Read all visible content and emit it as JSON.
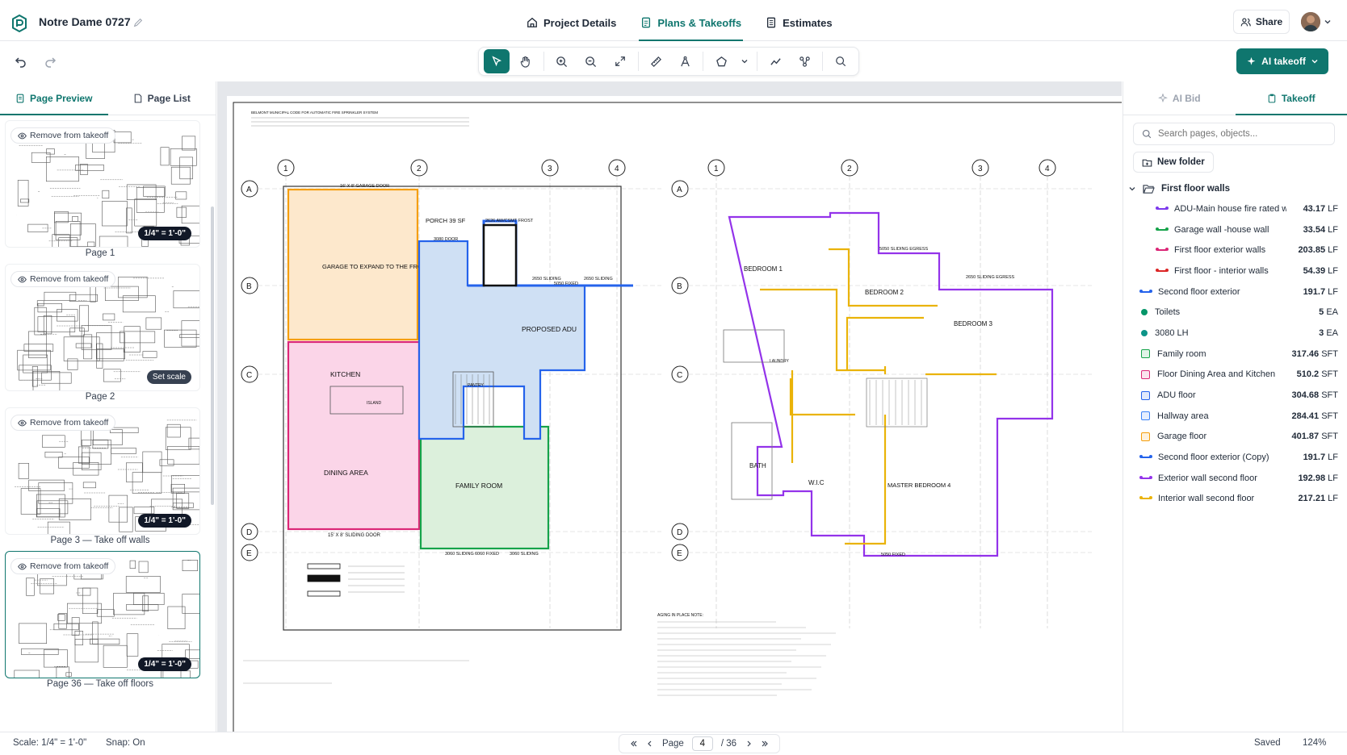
{
  "header": {
    "project_name": "Notre Dame 0727",
    "tabs": [
      "Project Details",
      "Plans & Takeoffs",
      "Estimates"
    ],
    "share_label": "Share"
  },
  "toolbar": {
    "ai_takeoff_label": "AI takeoff"
  },
  "left_panel": {
    "tabs": [
      "Page Preview",
      "Page List"
    ],
    "remove_label": "Remove from takeoff",
    "pages": [
      {
        "label": "Page 1",
        "badge": "1/4\" = 1'-0\""
      },
      {
        "label": "Page 2",
        "badge": "Set scale"
      },
      {
        "label": "Page 3 — Take off walls",
        "badge": "1/4\" = 1'-0\""
      },
      {
        "label": "Page 36 — Take off floors",
        "badge": "1/4\" = 1'-0\""
      }
    ]
  },
  "right_panel": {
    "tabs": [
      "AI Bid",
      "Takeoff"
    ],
    "search_placeholder": "Search pages, objects...",
    "new_folder_label": "New folder",
    "folder_name": "First floor walls",
    "items": [
      {
        "name": "ADU-Main house fire rated wall",
        "qty": "43.17",
        "unit": "LF",
        "color": "#7c3aed",
        "kind": "line",
        "indent": true
      },
      {
        "name": "Garage wall -house wall",
        "qty": "33.54",
        "unit": "LF",
        "color": "#16a34a",
        "kind": "line",
        "indent": true
      },
      {
        "name": "First floor exterior walls",
        "qty": "203.85",
        "unit": "LF",
        "color": "#db2777",
        "kind": "line",
        "indent": true
      },
      {
        "name": "First floor - interior walls",
        "qty": "54.39",
        "unit": "LF",
        "color": "#dc2626",
        "kind": "line",
        "indent": true
      },
      {
        "name": "Second floor exterior",
        "qty": "191.7",
        "unit": "LF",
        "color": "#2563eb",
        "kind": "line",
        "indent": false
      },
      {
        "name": "Toilets",
        "qty": "5",
        "unit": "EA",
        "color": "#059669",
        "kind": "dot",
        "indent": false
      },
      {
        "name": "3080 LH",
        "qty": "3",
        "unit": "EA",
        "color": "#0d9488",
        "kind": "dot",
        "indent": false
      },
      {
        "name": "Family room",
        "qty": "317.46",
        "unit": "SFT",
        "color": "#16a34a",
        "kind": "box",
        "indent": false
      },
      {
        "name": "Floor Dining Area and Kitchen",
        "qty": "510.2",
        "unit": "SFT",
        "color": "#db2777",
        "kind": "box",
        "indent": false
      },
      {
        "name": "ADU floor",
        "qty": "304.68",
        "unit": "SFT",
        "color": "#2563eb",
        "kind": "box",
        "indent": false
      },
      {
        "name": "Hallway area",
        "qty": "284.41",
        "unit": "SFT",
        "color": "#3b82f6",
        "kind": "box",
        "indent": false
      },
      {
        "name": "Garage floor",
        "qty": "401.87",
        "unit": "SFT",
        "color": "#f59e0b",
        "kind": "box",
        "indent": false
      },
      {
        "name": "Second floor exterior (Copy)",
        "qty": "191.7",
        "unit": "LF",
        "color": "#2563eb",
        "kind": "line",
        "indent": false
      },
      {
        "name": "Exterior wall second floor",
        "qty": "192.98",
        "unit": "LF",
        "color": "#9333ea",
        "kind": "line",
        "indent": false
      },
      {
        "name": "Interior wall second floor",
        "qty": "217.21",
        "unit": "LF",
        "color": "#eab308",
        "kind": "line",
        "indent": false
      }
    ]
  },
  "plan": {
    "note_top": "BELMONT MUNICIPAL CODE FOR AUTOMATIC FIRE SPRINKLER SYSTEM",
    "grid_cols": [
      "1",
      "2",
      "3",
      "4"
    ],
    "grid_rows": [
      "A",
      "B",
      "C",
      "D",
      "E"
    ],
    "rooms_left": {
      "garage": "GARAGE TO EXPAND TO THE FRONT",
      "garage_door": "16' X 8' GARAGE DOOR",
      "porch": "PORCH 39 SF",
      "adu": "PROPOSED ADU",
      "kitchen": "KITCHEN",
      "island": "ISLAND",
      "dining": "DINING AREA",
      "family": "FAMILY ROOM",
      "sliding_door": "15' X 8' SLIDING DOOR",
      "pantry": "PANTRY",
      "w3080": "3080 DOOR",
      "s3060a": "3060 SLIDING",
      "f6060": "6060 FIXED",
      "s3060b": "3060 SLIDING",
      "w2626": "2626 AW/CSMT FROST",
      "w2650a": "2650 SLIDING",
      "w5050": "5050 FIXED",
      "w2650b": "2650 SLIDING"
    },
    "rooms_right": {
      "bed1": "BEDROOM 1",
      "bed2": "BEDROOM 2",
      "bed3": "BEDROOM 3",
      "laundry": "LAUNDRY",
      "bath": "BATH",
      "wic": "W.I.C",
      "master": "MASTER BEDROOM 4",
      "w5050s": "5050 SLIDING EGRESS",
      "w2650e": "2650 SLIDING EGRESS",
      "w5050f": "5050 FIXED",
      "aging": "AGING IN PLACE NOTE:"
    }
  },
  "status": {
    "scale_label": "Scale:",
    "scale_value": "1/4\" = 1'-0\"",
    "snap_label": "Snap:",
    "snap_value": "On",
    "page_label": "Page",
    "page_current": "4",
    "page_total": "/ 36",
    "saved": "Saved",
    "zoom": "124%"
  }
}
